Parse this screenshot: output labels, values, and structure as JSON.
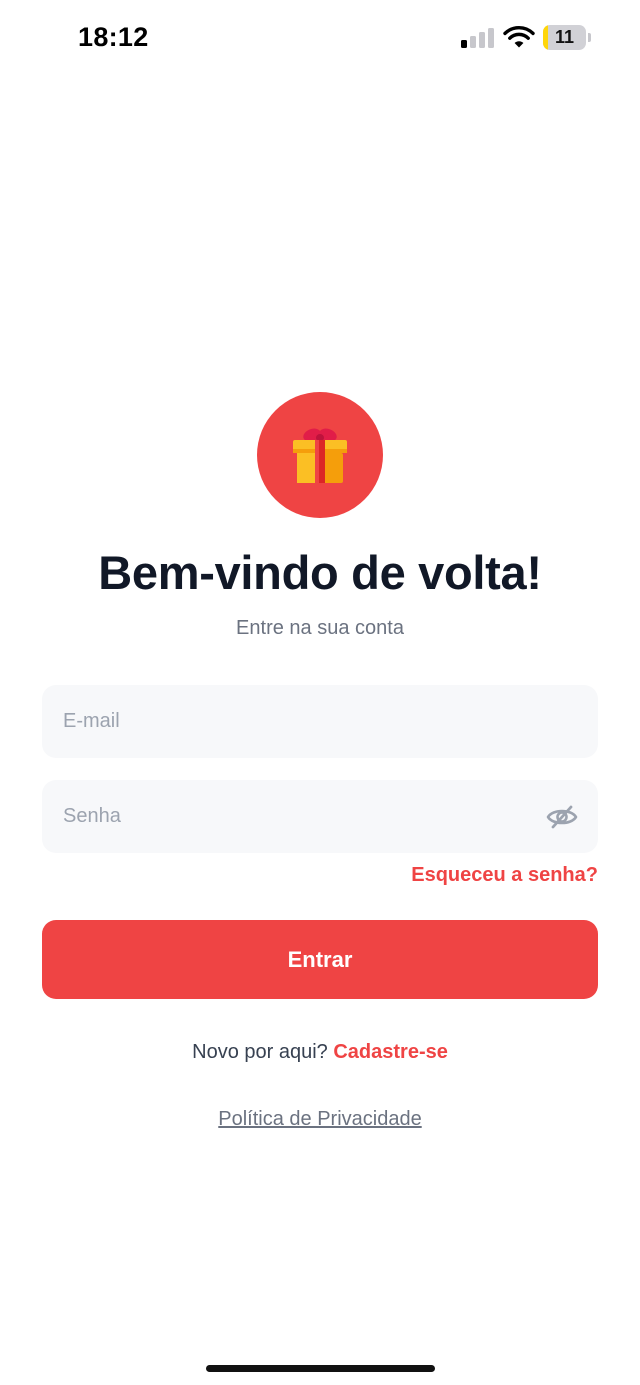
{
  "status_bar": {
    "time": "18:12",
    "battery_level": "11",
    "battery_fraction": 0.11,
    "signal_bars_active": 1,
    "signal_bars_total": 4,
    "icons": [
      "cellular-signal-icon",
      "wifi-icon",
      "battery-icon"
    ]
  },
  "logo": {
    "icon": "gift-icon",
    "background_color": "#ef4444"
  },
  "header": {
    "title": "Bem-vindo de volta!",
    "subtitle": "Entre na sua conta"
  },
  "form": {
    "email": {
      "value": "",
      "placeholder": "E-mail"
    },
    "password": {
      "value": "",
      "placeholder": "Senha",
      "toggle_icon": "eye-off-icon"
    },
    "forgot_password": "Esqueceu a senha?",
    "submit_label": "Entrar"
  },
  "signup": {
    "prompt": "Novo por aqui?",
    "link": "Cadastre-se"
  },
  "footer": {
    "privacy_link": "Política de Privacidade"
  },
  "colors": {
    "accent": "#ef4444",
    "title": "#111827",
    "muted": "#6b7280",
    "field_background": "#f7f8fa"
  }
}
